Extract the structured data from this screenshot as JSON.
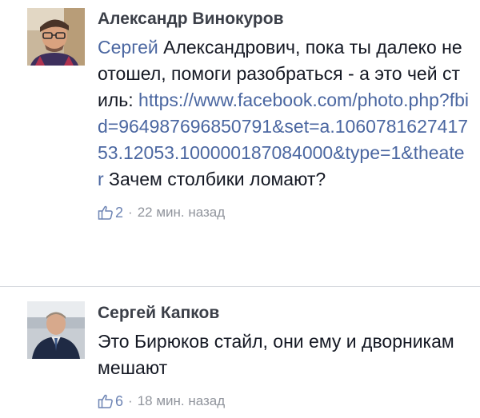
{
  "comments": [
    {
      "author": "Александр Винокуров",
      "mention": "Сергей",
      "text_line1": " Александрович, пока ты далеко не отошел, помоги разобраться - а это чей стиль: ",
      "link": "https://www.facebook.com/photo.php?fbid=964987696850791&set=a.106078162741753.12053.100000187084000&type=1&theater",
      "text_after": " Зачем столбики ломают?",
      "likes": "2",
      "time": "22 мин. назад"
    },
    {
      "author": "Сергей Капков",
      "text": "Это Бирюков стайл, они ему и дворникам мешают",
      "likes": "6",
      "time": "18 мин. назад"
    }
  ],
  "icons": {
    "like": "thumbs-up-icon"
  },
  "colors": {
    "link": "#4b67a1",
    "meta": "#90949c",
    "like": "#6d84b4"
  }
}
